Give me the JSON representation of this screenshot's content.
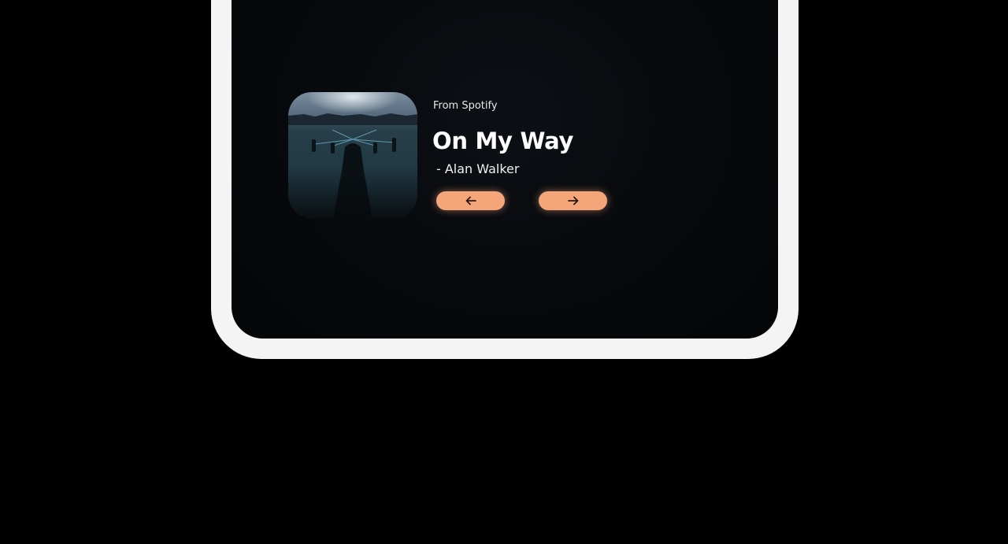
{
  "widget": {
    "source": "From Spotify",
    "title": "On My Way",
    "artist": "- Alan Walker",
    "album_art_icon": "album-cover",
    "prev_icon": "arrow-left-icon",
    "next_icon": "arrow-right-icon"
  },
  "colors": {
    "page_background": "#000000",
    "device_frame": "#f4f4f4",
    "screen_background": "#07090c",
    "button_accent": "#f5a57a",
    "text_primary": "#ffffff"
  }
}
